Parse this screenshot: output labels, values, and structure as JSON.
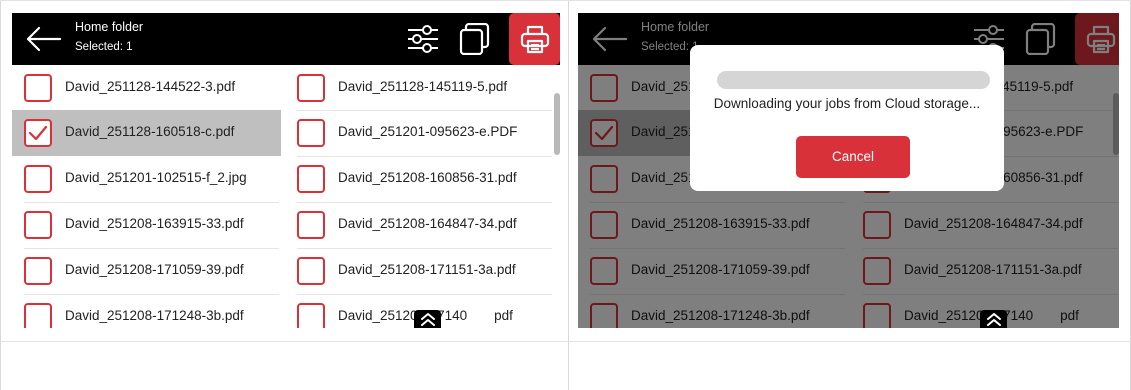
{
  "header": {
    "title": "Home folder",
    "subtitle": "Selected: 1"
  },
  "icons": {
    "back": "arrow-left-icon",
    "filter": "sliders-icon",
    "copies": "copies-icon",
    "print": "printer-icon",
    "scroll_top": "double-chevron-up-icon"
  },
  "colors": {
    "accent": "#d9313a",
    "topbar": "#000000",
    "selected_row": "#bfbfbf"
  },
  "files": [
    {
      "name": "David_251128-144522-3.pdf",
      "checked": false
    },
    {
      "name": "David_251128-145119-5.pdf",
      "checked": false
    },
    {
      "name": "David_251128-160518-c.pdf",
      "checked": true
    },
    {
      "name": "David_251201-095623-e.PDF",
      "checked": false
    },
    {
      "name": "David_251201-102515-f_2.jpg",
      "checked": false
    },
    {
      "name": "David_251208-160856-31.pdf",
      "checked": false
    },
    {
      "name": "David_251208-163915-33.pdf",
      "checked": false
    },
    {
      "name": "David_251208-164847-34.pdf",
      "checked": false
    },
    {
      "name": "David_251208-171059-39.pdf",
      "checked": false
    },
    {
      "name": "David_251208-171151-3a.pdf",
      "checked": false
    },
    {
      "name": "David_251208-171248-3b.pdf",
      "checked": false
    },
    {
      "name": "David_251208-17140",
      "tail": "pdf",
      "checked": false
    }
  ],
  "dialog": {
    "message": "Downloading your jobs from Cloud storage...",
    "cancel_label": "Cancel",
    "progress": 1.0
  }
}
